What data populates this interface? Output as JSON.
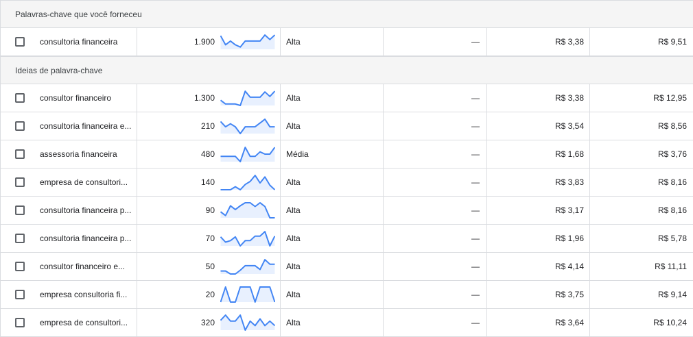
{
  "sections": [
    {
      "title": "Palavras-chave que você forneceu",
      "rows": [
        {
          "keyword": "consultoria financeira",
          "volume": "1.900",
          "competition": "Alta",
          "impr_share": "—",
          "bid_low": "R$ 3,38",
          "bid_high": "R$ 9,51",
          "trend": [
            0.9,
            0.3,
            0.55,
            0.3,
            0.15,
            0.55,
            0.55,
            0.55,
            0.55,
            0.95,
            0.65,
            0.95
          ]
        }
      ]
    },
    {
      "title": "Ideias de palavra-chave",
      "rows": [
        {
          "keyword": "consultor financeiro",
          "volume": "1.300",
          "competition": "Alta",
          "impr_share": "—",
          "bid_low": "R$ 3,38",
          "bid_high": "R$ 12,95",
          "trend": [
            0.35,
            0.1,
            0.1,
            0.1,
            0.0,
            0.95,
            0.55,
            0.55,
            0.55,
            0.9,
            0.6,
            0.95
          ]
        },
        {
          "keyword": "consultoria financeira e...",
          "volume": "210",
          "competition": "Alta",
          "impr_share": "—",
          "bid_low": "R$ 3,54",
          "bid_high": "R$ 8,56",
          "trend": [
            0.8,
            0.45,
            0.65,
            0.45,
            0.0,
            0.45,
            0.45,
            0.45,
            0.7,
            0.95,
            0.45,
            0.45
          ]
        },
        {
          "keyword": "assessoria financeira",
          "volume": "480",
          "competition": "Média",
          "impr_share": "—",
          "bid_low": "R$ 1,68",
          "bid_high": "R$ 3,76",
          "trend": [
            0.35,
            0.35,
            0.35,
            0.35,
            0.0,
            0.95,
            0.35,
            0.35,
            0.65,
            0.5,
            0.5,
            0.95
          ]
        },
        {
          "keyword": "empresa de consultori...",
          "volume": "140",
          "competition": "Alta",
          "impr_share": "—",
          "bid_low": "R$ 3,83",
          "bid_high": "R$ 8,16",
          "trend": [
            0.0,
            0.0,
            0.0,
            0.2,
            0.0,
            0.35,
            0.55,
            0.95,
            0.45,
            0.85,
            0.3,
            0.0
          ]
        },
        {
          "keyword": "consultoria financeira p...",
          "volume": "90",
          "competition": "Alta",
          "impr_share": "—",
          "bid_low": "R$ 3,17",
          "bid_high": "R$ 8,16",
          "trend": [
            0.4,
            0.15,
            0.8,
            0.55,
            0.8,
            1.0,
            1.0,
            0.75,
            1.0,
            0.75,
            0.0,
            0.0
          ]
        },
        {
          "keyword": "consultoria financeira p...",
          "volume": "70",
          "competition": "Alta",
          "impr_share": "—",
          "bid_low": "R$ 1,96",
          "bid_high": "R$ 5,78",
          "trend": [
            0.6,
            0.25,
            0.35,
            0.6,
            0.0,
            0.35,
            0.35,
            0.65,
            0.65,
            0.95,
            0.0,
            0.65
          ]
        },
        {
          "keyword": "consultor financeiro e...",
          "volume": "50",
          "competition": "Alta",
          "impr_share": "—",
          "bid_low": "R$ 4,14",
          "bid_high": "R$ 11,11",
          "trend": [
            0.2,
            0.2,
            0.0,
            0.0,
            0.25,
            0.55,
            0.55,
            0.55,
            0.3,
            0.95,
            0.65,
            0.65
          ]
        },
        {
          "keyword": "empresa consultoria fi...",
          "volume": "20",
          "competition": "Alta",
          "impr_share": "—",
          "bid_low": "R$ 3,75",
          "bid_high": "R$ 9,14",
          "trend": [
            0.0,
            1.0,
            0.0,
            0.0,
            1.0,
            1.0,
            1.0,
            0.0,
            1.0,
            1.0,
            1.0,
            0.0
          ]
        },
        {
          "keyword": "empresa de consultori...",
          "volume": "320",
          "competition": "Alta",
          "impr_share": "—",
          "bid_low": "R$ 3,64",
          "bid_high": "R$ 10,24",
          "trend": [
            0.65,
            1.0,
            0.6,
            0.6,
            1.0,
            0.0,
            0.6,
            0.3,
            0.75,
            0.3,
            0.6,
            0.3
          ]
        }
      ]
    }
  ],
  "colors": {
    "trend_line": "#4285f4",
    "trend_fill": "#e8f0fe"
  }
}
